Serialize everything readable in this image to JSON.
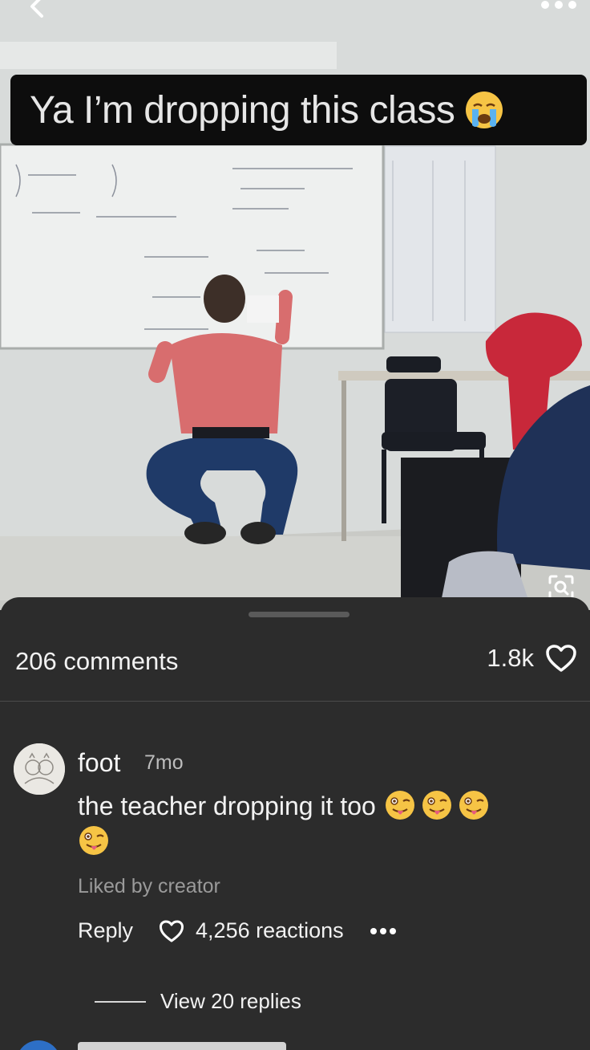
{
  "video": {
    "caption": "Ya I’m dropping this class",
    "caption_emoji_icon": "loudly-crying-face-icon"
  },
  "comments_panel": {
    "count_label": "206 comments",
    "likes_count": "1.8k",
    "comments": [
      {
        "username": "foot",
        "timestamp": "7mo",
        "text": "the teacher dropping it too",
        "emoji_icon": "winking-face-with-tongue-icon",
        "liked_by": "Liked by creator",
        "reply_label": "Reply",
        "reactions_label": "4,256 reactions",
        "view_replies_label": "View 20 replies"
      }
    ]
  },
  "colors": {
    "sheet_background": "#2c2c2c",
    "caption_background": "#0d0d0d",
    "secondary_text": "#9a9a9a"
  }
}
